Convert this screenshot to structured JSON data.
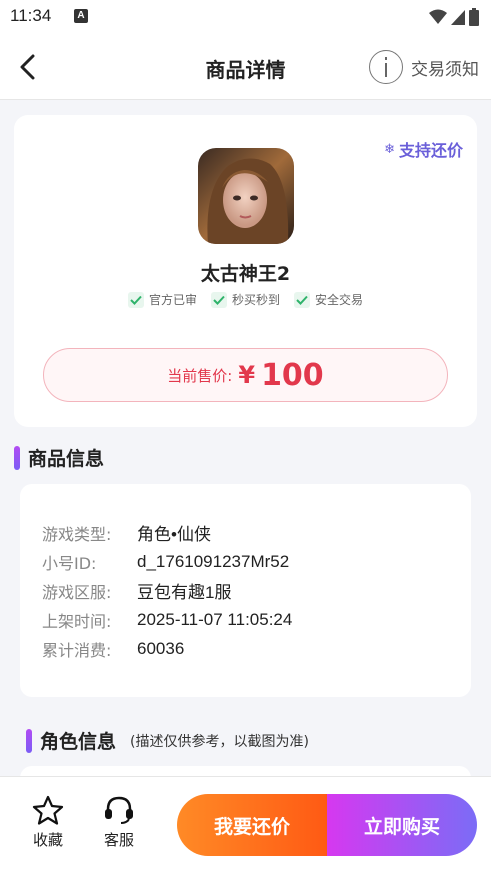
{
  "status_bar": {
    "time": "11:34",
    "notification_letter": "A",
    "icons": [
      "wifi-icon",
      "signal-icon",
      "battery-icon"
    ]
  },
  "header": {
    "title": "商品详情",
    "notice_label": "交易须知",
    "icons": [
      "back-arrow-icon",
      "info-circle-icon"
    ]
  },
  "product": {
    "bargain_tag": "支持还价",
    "game_name": "太古神王2",
    "badges": [
      "官方已审",
      "秒买秒到",
      "安全交易"
    ],
    "price_label": "当前售价:",
    "price_currency": "¥",
    "price_value": "100"
  },
  "goods_info": {
    "title": "商品信息",
    "rows": [
      {
        "key": "游戏类型:",
        "value": "角色•仙侠"
      },
      {
        "key": "小号ID:",
        "value": "d_1761091237Mr52"
      },
      {
        "key": "游戏区服:",
        "value": "豆包有趣1服"
      },
      {
        "key": "上架时间:",
        "value": "2025-11-07 11:05:24"
      },
      {
        "key": "累计消费:",
        "value": "60036"
      }
    ]
  },
  "role_info": {
    "title": "角色信息",
    "note": "(描述仅供参考，以截图为准)"
  },
  "bottom_bar": {
    "favorite_label": "收藏",
    "service_label": "客服",
    "bargain_button": "我要还价",
    "buy_button": "立即购买"
  },
  "colors": {
    "accent_purple": "#6a5fd9",
    "price_red": "#e2384c",
    "bargain_orange": "#ff6a1a",
    "buy_gradient_start": "#d638f0",
    "buy_gradient_end": "#7b6cf6",
    "check_green": "#2fb36b"
  }
}
